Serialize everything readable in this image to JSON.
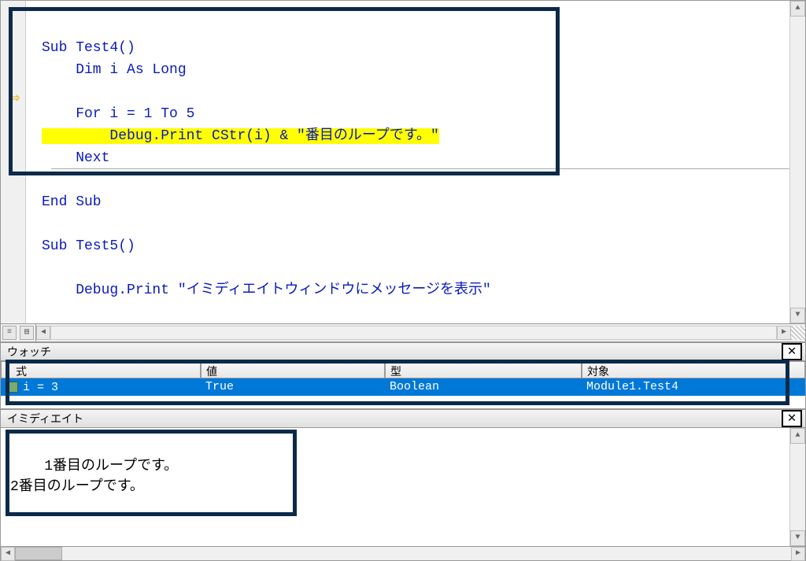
{
  "code": {
    "sub1_start": "Sub Test4()",
    "dim_line": "    Dim i As Long",
    "for_line": "    For i = 1 To 5",
    "debug_print_hl": "        Debug.Print CStr(i) & \"番目のループです。\"",
    "next_line": "    Next",
    "end_sub1": "End Sub",
    "sub2_start": "Sub Test5()",
    "debug_print2": "    Debug.Print \"イミディエイトウィンドウにメッセージを表示\""
  },
  "watch": {
    "title": "ウォッチ",
    "cols": {
      "expr": "式",
      "value": "値",
      "type": "型",
      "context": "対象"
    },
    "row": {
      "expr": "i = 3",
      "value": "True",
      "type": "Boolean",
      "context": "Module1.Test4"
    }
  },
  "immediate": {
    "title": "イミディエイト",
    "lines": "1番目のループです。\n2番目のループです。"
  },
  "glyphs": {
    "arrow": "⇨",
    "close": "✕",
    "up": "▲",
    "down": "▼",
    "left": "◀",
    "right": "▶",
    "view1": "≡",
    "view2": "▤"
  }
}
